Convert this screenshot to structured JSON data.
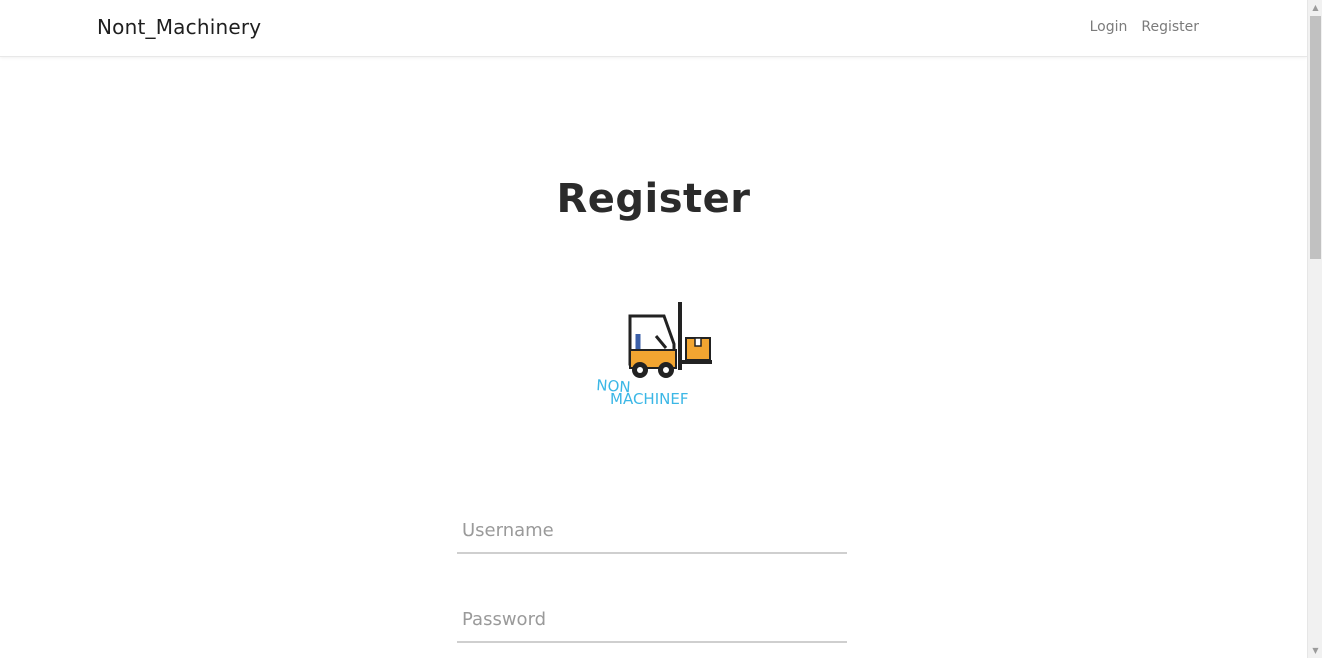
{
  "navbar": {
    "brand": "Nont_Machinery",
    "links": [
      {
        "label": "Login"
      },
      {
        "label": "Register"
      }
    ]
  },
  "main": {
    "title": "Register",
    "logo": {
      "icon": "forklift-icon",
      "line1": "NON",
      "line2": "MACHINEF"
    },
    "fields": {
      "username_placeholder": "Username",
      "password_placeholder": "Password"
    }
  },
  "colors": {
    "logo_text": "#3bb7e6",
    "forklift_body": "#f2a531",
    "seat": "#3b5fa8"
  }
}
